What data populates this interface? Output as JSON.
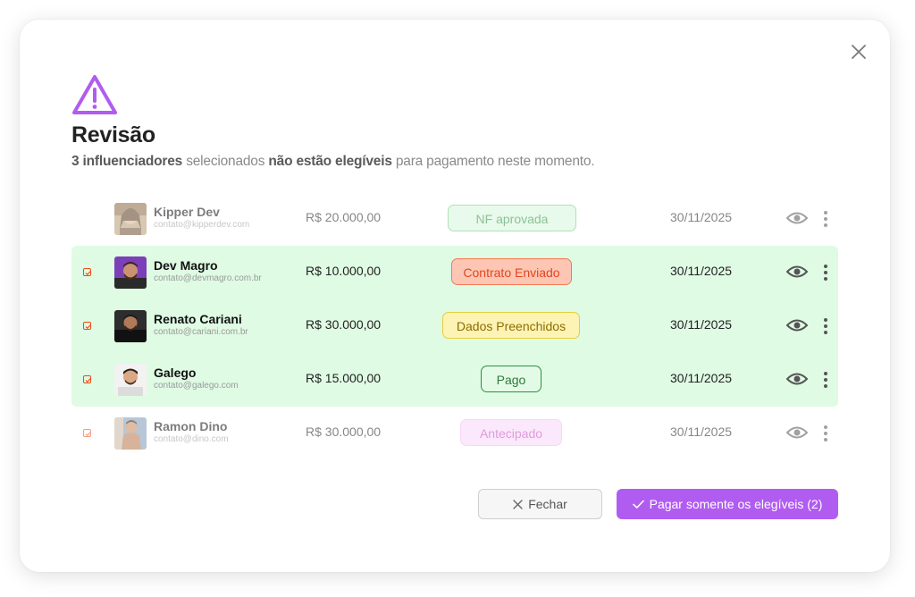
{
  "modal": {
    "title": "Revisão",
    "subtitle": {
      "count": "3 influenciadores",
      "middle": " selecionados ",
      "emph": "não estão elegíveis",
      "end": " para pagamento neste momento."
    }
  },
  "icons": {
    "close": "close-icon",
    "warning": "warning-triangle-icon",
    "eye": "eye-icon",
    "more": "more-vertical-icon",
    "check": "check-icon"
  },
  "colors": {
    "accent": "#b15cf0",
    "eligible_row": "#dffbe4",
    "checkbox": "#f04a14"
  },
  "rows": [
    {
      "name": "Kipper Dev",
      "email": "contato@kipperdev.com",
      "amount": "R$ 20.000,00",
      "status": "NF aprovada",
      "date": "30/11/2025",
      "eligible": false,
      "checkbox": false
    },
    {
      "name": "Dev Magro",
      "email": "contato@devmagro.com.br",
      "amount": "R$ 10.000,00",
      "status": "Contrato Enviado",
      "date": "30/11/2025",
      "eligible": true,
      "checkbox": true
    },
    {
      "name": "Renato Cariani",
      "email": "contato@cariani.com.br",
      "amount": "R$ 30.000,00",
      "status": "Dados Preenchidos",
      "date": "30/11/2025",
      "eligible": true,
      "checkbox": true
    },
    {
      "name": "Galego",
      "email": "contato@galego.com",
      "amount": "R$ 15.000,00",
      "status": "Pago",
      "date": "30/11/2025",
      "eligible": true,
      "checkbox": true
    },
    {
      "name": "Ramon Dino",
      "email": "contato@dino.com",
      "amount": "R$ 30.000,00",
      "status": "Antecipado",
      "date": "30/11/2025",
      "eligible": false,
      "checkbox": true
    }
  ],
  "buttons": {
    "close_label": "Fechar",
    "pay_label": "Pagar somente os elegíveis (2)"
  }
}
